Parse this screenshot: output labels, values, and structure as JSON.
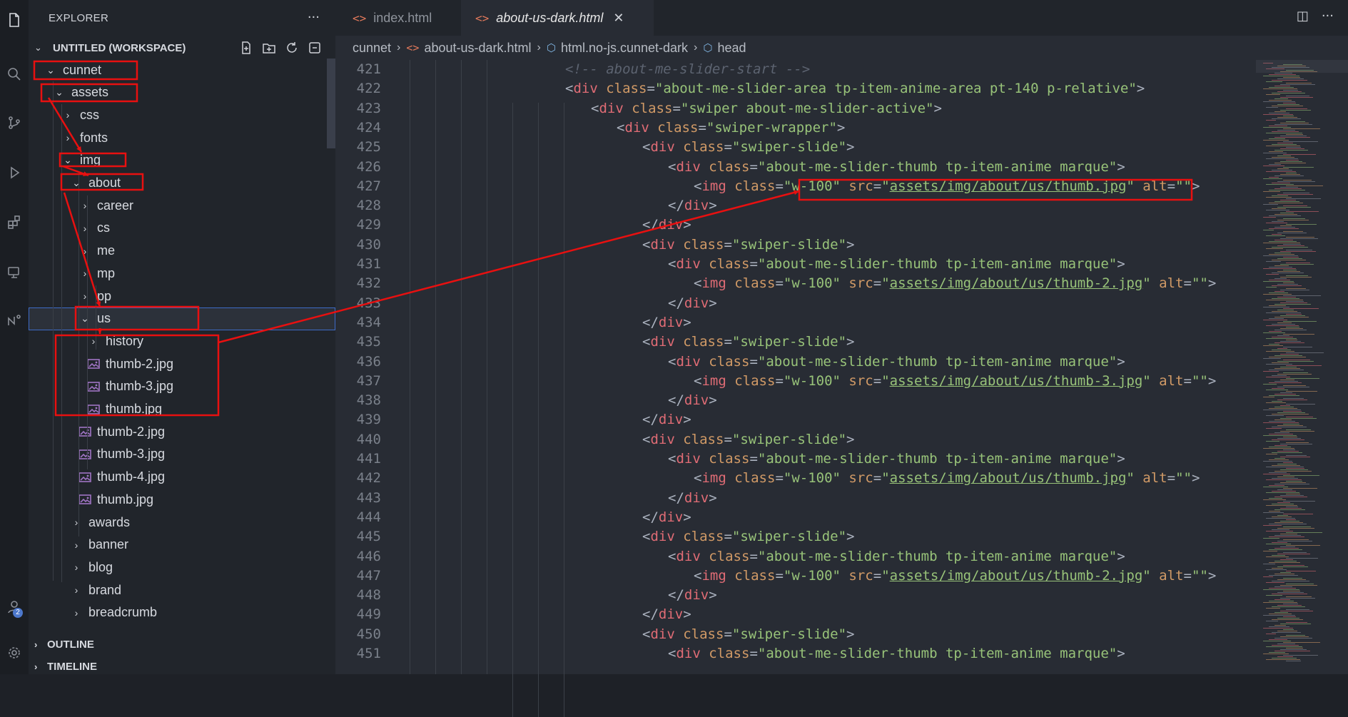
{
  "sidebar": {
    "title": "EXPLORER",
    "more": "···",
    "workspace": "UNTITLED (WORKSPACE)",
    "tree": [
      {
        "label": "cunnet",
        "depth": 0,
        "kind": "folder",
        "open": true
      },
      {
        "label": "assets",
        "depth": 1,
        "kind": "folder",
        "open": true
      },
      {
        "label": "css",
        "depth": 2,
        "kind": "folder",
        "open": false
      },
      {
        "label": "fonts",
        "depth": 2,
        "kind": "folder",
        "open": false
      },
      {
        "label": "img",
        "depth": 2,
        "kind": "folder",
        "open": true
      },
      {
        "label": "about",
        "depth": 3,
        "kind": "folder",
        "open": true
      },
      {
        "label": "career",
        "depth": 4,
        "kind": "folder",
        "open": false
      },
      {
        "label": "cs",
        "depth": 4,
        "kind": "folder",
        "open": false
      },
      {
        "label": "me",
        "depth": 4,
        "kind": "folder",
        "open": false
      },
      {
        "label": "mp",
        "depth": 4,
        "kind": "folder",
        "open": false
      },
      {
        "label": "pp",
        "depth": 4,
        "kind": "folder",
        "open": false
      },
      {
        "label": "us",
        "depth": 4,
        "kind": "folder",
        "open": true,
        "selected": true
      },
      {
        "label": "history",
        "depth": 5,
        "kind": "folder",
        "open": false
      },
      {
        "label": "thumb-2.jpg",
        "depth": 5,
        "kind": "image"
      },
      {
        "label": "thumb-3.jpg",
        "depth": 5,
        "kind": "image"
      },
      {
        "label": "thumb.jpg",
        "depth": 5,
        "kind": "image"
      },
      {
        "label": "thumb-2.jpg",
        "depth": 4,
        "kind": "image"
      },
      {
        "label": "thumb-3.jpg",
        "depth": 4,
        "kind": "image"
      },
      {
        "label": "thumb-4.jpg",
        "depth": 4,
        "kind": "image"
      },
      {
        "label": "thumb.jpg",
        "depth": 4,
        "kind": "image"
      },
      {
        "label": "awards",
        "depth": 3,
        "kind": "folder",
        "open": false
      },
      {
        "label": "banner",
        "depth": 3,
        "kind": "folder",
        "open": false
      },
      {
        "label": "blog",
        "depth": 3,
        "kind": "folder",
        "open": false
      },
      {
        "label": "brand",
        "depth": 3,
        "kind": "folder",
        "open": false
      },
      {
        "label": "breadcrumb",
        "depth": 3,
        "kind": "folder",
        "open": false
      }
    ],
    "outline": "OUTLINE",
    "timeline": "TIMELINE"
  },
  "activity": {
    "badge": "2"
  },
  "tabs": [
    {
      "label": "index.html",
      "active": false
    },
    {
      "label": "about-us-dark.html",
      "active": true
    }
  ],
  "breadcrumb": [
    "cunnet",
    "about-us-dark.html",
    "html.no-js.cunnet-dark",
    "head"
  ],
  "code": [
    {
      "n": "421",
      "indent": 4,
      "tokens": [
        [
          "com",
          "<!-- about-me-slider-start -->"
        ]
      ]
    },
    {
      "n": "422",
      "indent": 4,
      "tokens": [
        [
          "pun",
          "<"
        ],
        [
          "tag",
          "div"
        ],
        [
          "pun",
          " "
        ],
        [
          "attr",
          "class"
        ],
        [
          "pun",
          "="
        ],
        [
          "str",
          "\"about-me-slider-area tp-item-anime-area pt-140 p-relative\""
        ],
        [
          "pun",
          ">"
        ]
      ]
    },
    {
      "n": "423",
      "indent": 5,
      "tokens": [
        [
          "pun",
          "<"
        ],
        [
          "tag",
          "div"
        ],
        [
          "pun",
          " "
        ],
        [
          "attr",
          "class"
        ],
        [
          "pun",
          "="
        ],
        [
          "str",
          "\"swiper about-me-slider-active\""
        ],
        [
          "pun",
          ">"
        ]
      ]
    },
    {
      "n": "424",
      "indent": 6,
      "tokens": [
        [
          "pun",
          "<"
        ],
        [
          "tag",
          "div"
        ],
        [
          "pun",
          " "
        ],
        [
          "attr",
          "class"
        ],
        [
          "pun",
          "="
        ],
        [
          "str",
          "\"swiper-wrapper\""
        ],
        [
          "pun",
          ">"
        ]
      ]
    },
    {
      "n": "425",
      "indent": 7,
      "tokens": [
        [
          "pun",
          "<"
        ],
        [
          "tag",
          "div"
        ],
        [
          "pun",
          " "
        ],
        [
          "attr",
          "class"
        ],
        [
          "pun",
          "="
        ],
        [
          "str",
          "\"swiper-slide\""
        ],
        [
          "pun",
          ">"
        ]
      ]
    },
    {
      "n": "426",
      "indent": 8,
      "tokens": [
        [
          "pun",
          "<"
        ],
        [
          "tag",
          "div"
        ],
        [
          "pun",
          " "
        ],
        [
          "attr",
          "class"
        ],
        [
          "pun",
          "="
        ],
        [
          "str",
          "\"about-me-slider-thumb tp-item-anime marque\""
        ],
        [
          "pun",
          ">"
        ]
      ]
    },
    {
      "n": "427",
      "indent": 9,
      "tokens": [
        [
          "pun",
          "<"
        ],
        [
          "tag",
          "img"
        ],
        [
          "pun",
          " "
        ],
        [
          "attr",
          "class"
        ],
        [
          "pun",
          "="
        ],
        [
          "str",
          "\"w-100\""
        ],
        [
          "pun",
          " "
        ],
        [
          "attr",
          "src"
        ],
        [
          "pun",
          "="
        ],
        [
          "str",
          "\""
        ],
        [
          "link",
          "assets/img/about/us/thumb.jpg"
        ],
        [
          "str",
          "\""
        ],
        [
          "pun",
          " "
        ],
        [
          "attr",
          "alt"
        ],
        [
          "pun",
          "="
        ],
        [
          "str",
          "\"\""
        ],
        [
          "pun",
          ">"
        ]
      ]
    },
    {
      "n": "428",
      "indent": 8,
      "tokens": [
        [
          "pun",
          "</"
        ],
        [
          "tag",
          "div"
        ],
        [
          "pun",
          ">"
        ]
      ]
    },
    {
      "n": "429",
      "indent": 7,
      "tokens": [
        [
          "pun",
          "</"
        ],
        [
          "tag",
          "div"
        ],
        [
          "pun",
          ">"
        ]
      ]
    },
    {
      "n": "430",
      "indent": 7,
      "tokens": [
        [
          "pun",
          "<"
        ],
        [
          "tag",
          "div"
        ],
        [
          "pun",
          " "
        ],
        [
          "attr",
          "class"
        ],
        [
          "pun",
          "="
        ],
        [
          "str",
          "\"swiper-slide\""
        ],
        [
          "pun",
          ">"
        ]
      ]
    },
    {
      "n": "431",
      "indent": 8,
      "tokens": [
        [
          "pun",
          "<"
        ],
        [
          "tag",
          "div"
        ],
        [
          "pun",
          " "
        ],
        [
          "attr",
          "class"
        ],
        [
          "pun",
          "="
        ],
        [
          "str",
          "\"about-me-slider-thumb tp-item-anime marque\""
        ],
        [
          "pun",
          ">"
        ]
      ]
    },
    {
      "n": "432",
      "indent": 9,
      "tokens": [
        [
          "pun",
          "<"
        ],
        [
          "tag",
          "img"
        ],
        [
          "pun",
          " "
        ],
        [
          "attr",
          "class"
        ],
        [
          "pun",
          "="
        ],
        [
          "str",
          "\"w-100\""
        ],
        [
          "pun",
          " "
        ],
        [
          "attr",
          "src"
        ],
        [
          "pun",
          "="
        ],
        [
          "str",
          "\""
        ],
        [
          "link",
          "assets/img/about/us/thumb-2.jpg"
        ],
        [
          "str",
          "\""
        ],
        [
          "pun",
          " "
        ],
        [
          "attr",
          "alt"
        ],
        [
          "pun",
          "="
        ],
        [
          "str",
          "\"\""
        ],
        [
          "pun",
          ">"
        ]
      ]
    },
    {
      "n": "433",
      "indent": 8,
      "tokens": [
        [
          "pun",
          "</"
        ],
        [
          "tag",
          "div"
        ],
        [
          "pun",
          ">"
        ]
      ]
    },
    {
      "n": "434",
      "indent": 7,
      "tokens": [
        [
          "pun",
          "</"
        ],
        [
          "tag",
          "div"
        ],
        [
          "pun",
          ">"
        ]
      ]
    },
    {
      "n": "435",
      "indent": 7,
      "tokens": [
        [
          "pun",
          "<"
        ],
        [
          "tag",
          "div"
        ],
        [
          "pun",
          " "
        ],
        [
          "attr",
          "class"
        ],
        [
          "pun",
          "="
        ],
        [
          "str",
          "\"swiper-slide\""
        ],
        [
          "pun",
          ">"
        ]
      ]
    },
    {
      "n": "436",
      "indent": 8,
      "tokens": [
        [
          "pun",
          "<"
        ],
        [
          "tag",
          "div"
        ],
        [
          "pun",
          " "
        ],
        [
          "attr",
          "class"
        ],
        [
          "pun",
          "="
        ],
        [
          "str",
          "\"about-me-slider-thumb tp-item-anime marque\""
        ],
        [
          "pun",
          ">"
        ]
      ]
    },
    {
      "n": "437",
      "indent": 9,
      "tokens": [
        [
          "pun",
          "<"
        ],
        [
          "tag",
          "img"
        ],
        [
          "pun",
          " "
        ],
        [
          "attr",
          "class"
        ],
        [
          "pun",
          "="
        ],
        [
          "str",
          "\"w-100\""
        ],
        [
          "pun",
          " "
        ],
        [
          "attr",
          "src"
        ],
        [
          "pun",
          "="
        ],
        [
          "str",
          "\""
        ],
        [
          "link",
          "assets/img/about/us/thumb-3.jpg"
        ],
        [
          "str",
          "\""
        ],
        [
          "pun",
          " "
        ],
        [
          "attr",
          "alt"
        ],
        [
          "pun",
          "="
        ],
        [
          "str",
          "\"\""
        ],
        [
          "pun",
          ">"
        ]
      ]
    },
    {
      "n": "438",
      "indent": 8,
      "tokens": [
        [
          "pun",
          "</"
        ],
        [
          "tag",
          "div"
        ],
        [
          "pun",
          ">"
        ]
      ]
    },
    {
      "n": "439",
      "indent": 7,
      "tokens": [
        [
          "pun",
          "</"
        ],
        [
          "tag",
          "div"
        ],
        [
          "pun",
          ">"
        ]
      ]
    },
    {
      "n": "440",
      "indent": 7,
      "tokens": [
        [
          "pun",
          "<"
        ],
        [
          "tag",
          "div"
        ],
        [
          "pun",
          " "
        ],
        [
          "attr",
          "class"
        ],
        [
          "pun",
          "="
        ],
        [
          "str",
          "\"swiper-slide\""
        ],
        [
          "pun",
          ">"
        ]
      ]
    },
    {
      "n": "441",
      "indent": 8,
      "tokens": [
        [
          "pun",
          "<"
        ],
        [
          "tag",
          "div"
        ],
        [
          "pun",
          " "
        ],
        [
          "attr",
          "class"
        ],
        [
          "pun",
          "="
        ],
        [
          "str",
          "\"about-me-slider-thumb tp-item-anime marque\""
        ],
        [
          "pun",
          ">"
        ]
      ]
    },
    {
      "n": "442",
      "indent": 9,
      "tokens": [
        [
          "pun",
          "<"
        ],
        [
          "tag",
          "img"
        ],
        [
          "pun",
          " "
        ],
        [
          "attr",
          "class"
        ],
        [
          "pun",
          "="
        ],
        [
          "str",
          "\"w-100\""
        ],
        [
          "pun",
          " "
        ],
        [
          "attr",
          "src"
        ],
        [
          "pun",
          "="
        ],
        [
          "str",
          "\""
        ],
        [
          "link",
          "assets/img/about/us/thumb.jpg"
        ],
        [
          "str",
          "\""
        ],
        [
          "pun",
          " "
        ],
        [
          "attr",
          "alt"
        ],
        [
          "pun",
          "="
        ],
        [
          "str",
          "\"\""
        ],
        [
          "pun",
          ">"
        ]
      ]
    },
    {
      "n": "443",
      "indent": 8,
      "tokens": [
        [
          "pun",
          "</"
        ],
        [
          "tag",
          "div"
        ],
        [
          "pun",
          ">"
        ]
      ]
    },
    {
      "n": "444",
      "indent": 7,
      "tokens": [
        [
          "pun",
          "</"
        ],
        [
          "tag",
          "div"
        ],
        [
          "pun",
          ">"
        ]
      ]
    },
    {
      "n": "445",
      "indent": 7,
      "tokens": [
        [
          "pun",
          "<"
        ],
        [
          "tag",
          "div"
        ],
        [
          "pun",
          " "
        ],
        [
          "attr",
          "class"
        ],
        [
          "pun",
          "="
        ],
        [
          "str",
          "\"swiper-slide\""
        ],
        [
          "pun",
          ">"
        ]
      ]
    },
    {
      "n": "446",
      "indent": 8,
      "tokens": [
        [
          "pun",
          "<"
        ],
        [
          "tag",
          "div"
        ],
        [
          "pun",
          " "
        ],
        [
          "attr",
          "class"
        ],
        [
          "pun",
          "="
        ],
        [
          "str",
          "\"about-me-slider-thumb tp-item-anime marque\""
        ],
        [
          "pun",
          ">"
        ]
      ]
    },
    {
      "n": "447",
      "indent": 9,
      "tokens": [
        [
          "pun",
          "<"
        ],
        [
          "tag",
          "img"
        ],
        [
          "pun",
          " "
        ],
        [
          "attr",
          "class"
        ],
        [
          "pun",
          "="
        ],
        [
          "str",
          "\"w-100\""
        ],
        [
          "pun",
          " "
        ],
        [
          "attr",
          "src"
        ],
        [
          "pun",
          "="
        ],
        [
          "str",
          "\""
        ],
        [
          "link",
          "assets/img/about/us/thumb-2.jpg"
        ],
        [
          "str",
          "\""
        ],
        [
          "pun",
          " "
        ],
        [
          "attr",
          "alt"
        ],
        [
          "pun",
          "="
        ],
        [
          "str",
          "\"\""
        ],
        [
          "pun",
          ">"
        ]
      ]
    },
    {
      "n": "448",
      "indent": 8,
      "tokens": [
        [
          "pun",
          "</"
        ],
        [
          "tag",
          "div"
        ],
        [
          "pun",
          ">"
        ]
      ]
    },
    {
      "n": "449",
      "indent": 7,
      "tokens": [
        [
          "pun",
          "</"
        ],
        [
          "tag",
          "div"
        ],
        [
          "pun",
          ">"
        ]
      ]
    },
    {
      "n": "450",
      "indent": 7,
      "tokens": [
        [
          "pun",
          "<"
        ],
        [
          "tag",
          "div"
        ],
        [
          "pun",
          " "
        ],
        [
          "attr",
          "class"
        ],
        [
          "pun",
          "="
        ],
        [
          "str",
          "\"swiper-slide\""
        ],
        [
          "pun",
          ">"
        ]
      ]
    },
    {
      "n": "451",
      "indent": 8,
      "tokens": [
        [
          "pun",
          "<"
        ],
        [
          "tag",
          "div"
        ],
        [
          "pun",
          " "
        ],
        [
          "attr",
          "class"
        ],
        [
          "pun",
          "="
        ],
        [
          "str",
          "\"about-me-slider-thumb tp-item-anime marque\""
        ],
        [
          "pun",
          ">"
        ]
      ]
    }
  ],
  "colors": {
    "annotation": "#e81010",
    "tag": "#e06c75",
    "attr": "#d19a66",
    "string": "#98c379",
    "comment": "#5c6370",
    "file_icon": "#e2795b",
    "image_icon": "#a074c4"
  }
}
